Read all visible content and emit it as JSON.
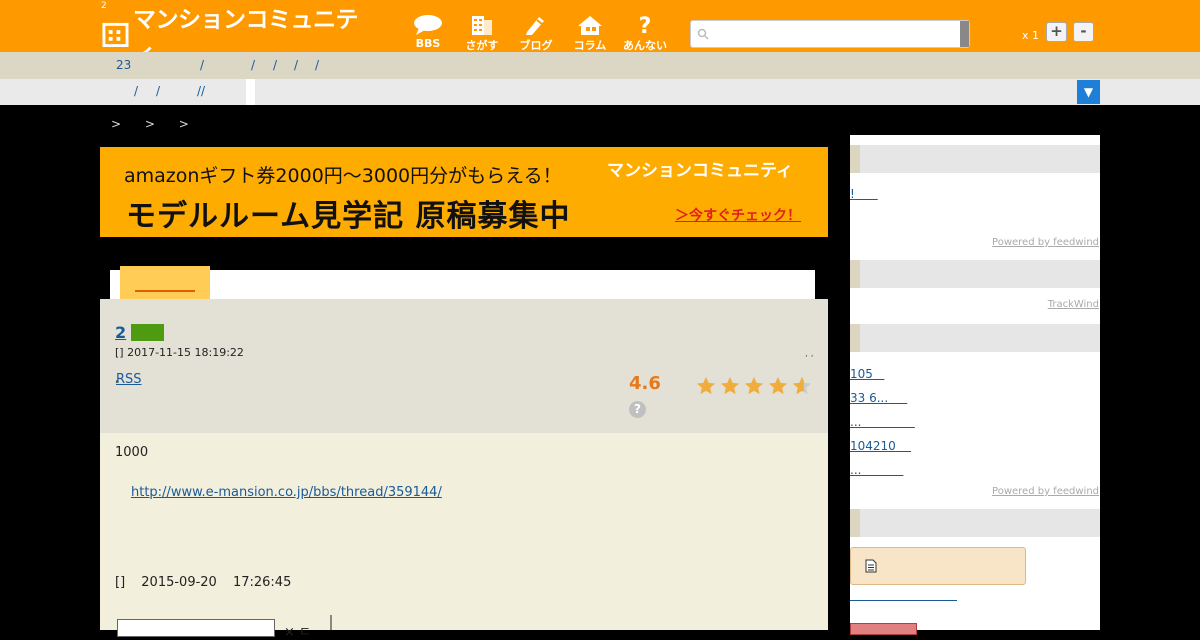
{
  "header": {
    "small_num": "2",
    "logo_text": "マンションコミュニティ",
    "nav": [
      {
        "label": "BBS",
        "icon": "speech-bubble-icon"
      },
      {
        "label": "さがす",
        "icon": "building-icon"
      },
      {
        "label": "ブログ",
        "icon": "pen-icon"
      },
      {
        "label": "コラム",
        "icon": "house-icon"
      },
      {
        "label": "あんない",
        "icon": "question-icon"
      }
    ],
    "search_placeholder": "",
    "zoom_label": "x 1",
    "zoom_plus": "+",
    "zoom_minus": "-"
  },
  "subnav": {
    "row1": [
      "23",
      "/",
      "/",
      "/",
      "/",
      "/"
    ],
    "row2": [
      "/",
      "/",
      "//"
    ],
    "dropdown": "▼"
  },
  "breadcrumb": "> > >",
  "banner": {
    "line1": "amazonギフト券2000円〜3000円分がもらえる！",
    "line2": "モデルルーム見学記 原稿募集中",
    "brand": "マンションコミュニティ",
    "cta": "＞今すぐチェック！"
  },
  "thread": {
    "number": "2",
    "date": "[] 2017-11-15 18:19:22",
    "rss": "RSS",
    "rss_prefix": ",",
    "tick": ", ,",
    "rating": "4.6",
    "rating_value": 4.6,
    "rating_max": 5,
    "help": "?",
    "body_text": "1000",
    "body_link": "http://www.e-mansion.co.jp/bbs/thread/359144/",
    "post_date": "[] 2015-09-20 17:26:45",
    "close_label": "× ㄷ"
  },
  "sidebar": {
    "link1": "!",
    "powered1": "Powered by feedwind",
    "trackwind": "TrackWind",
    "links": [
      "105",
      "33 6...",
      "...",
      "104210",
      "..."
    ],
    "powered2": "Powered by feedwind",
    "accent_color": "#ff9900"
  }
}
